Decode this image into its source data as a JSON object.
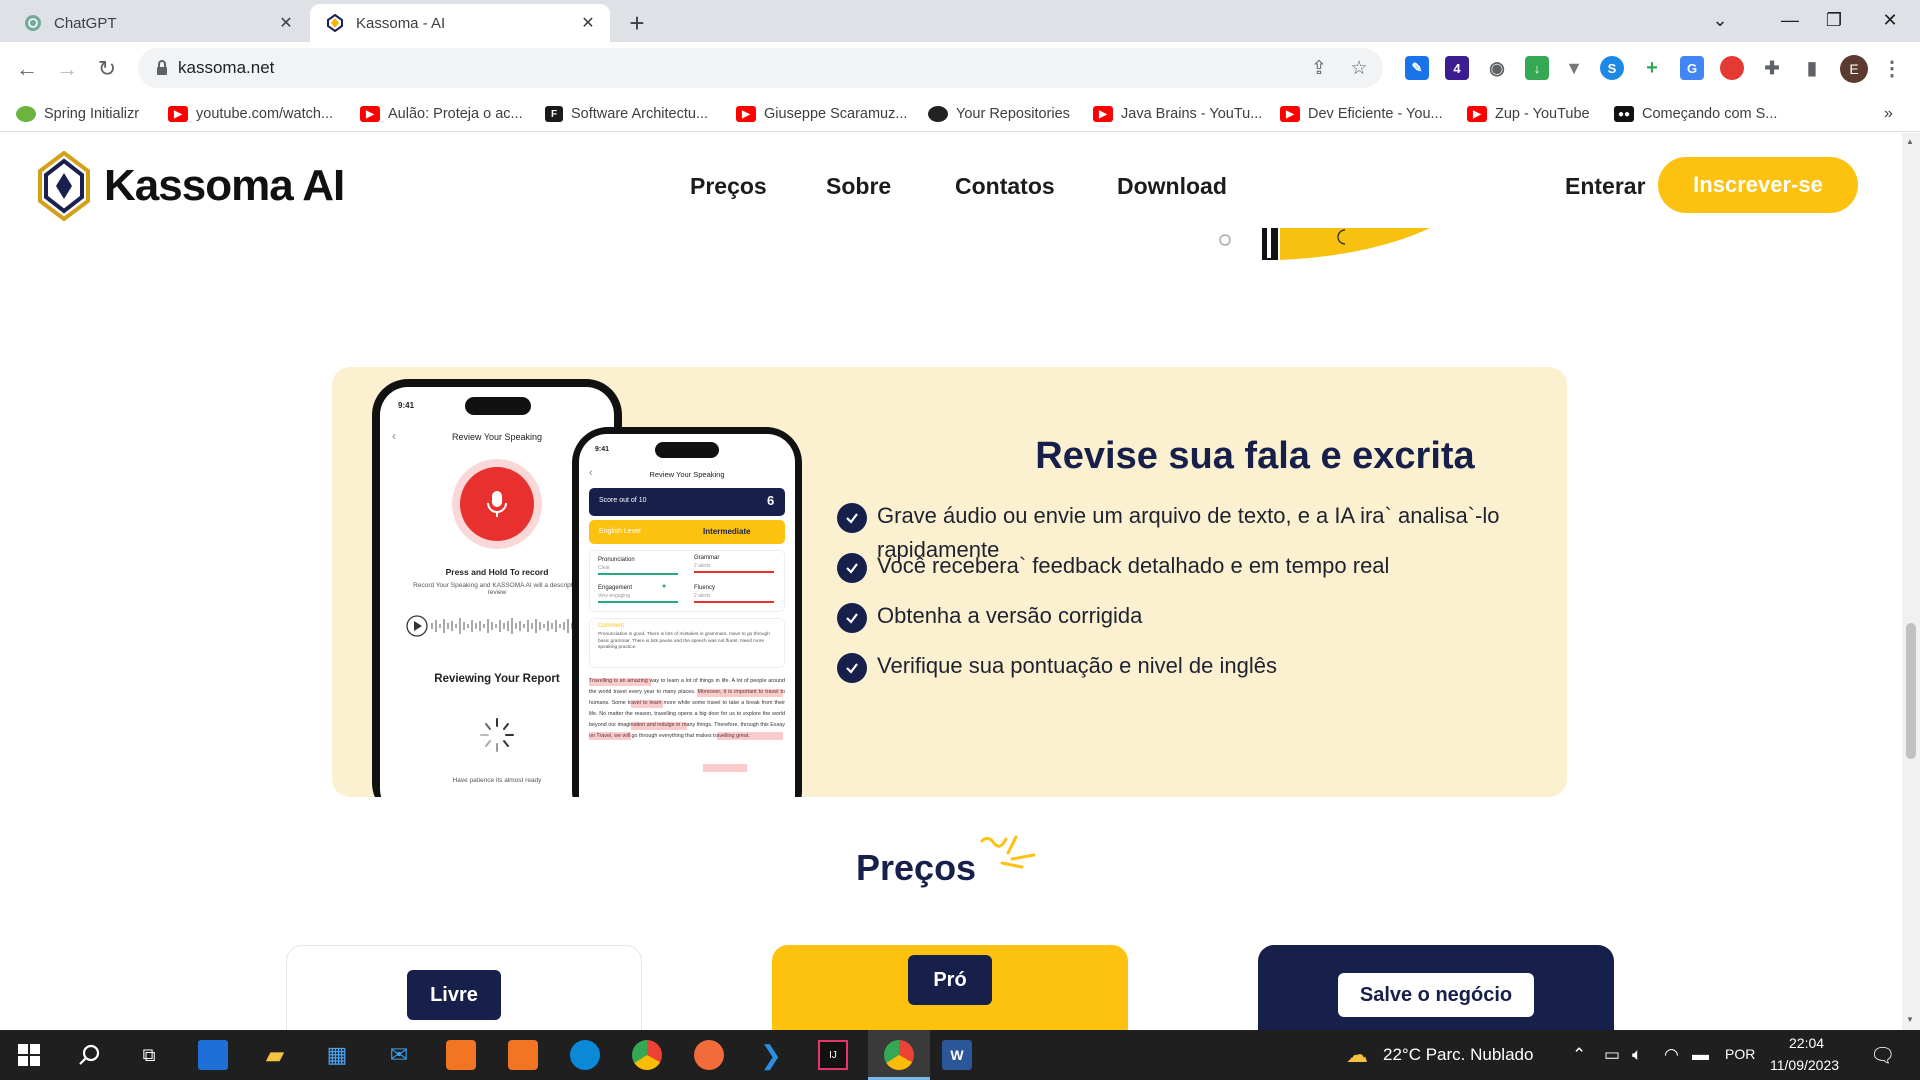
{
  "browser": {
    "tabs": [
      {
        "title": "ChatGPT",
        "active": false
      },
      {
        "title": "Kassoma - AI",
        "active": true
      }
    ],
    "url": "kassoma.net",
    "profile_initial": "E",
    "bookmarks": [
      {
        "label": "Spring Initializr",
        "icon": "spring-icon"
      },
      {
        "label": "youtube.com/watch...",
        "icon": "youtube-icon"
      },
      {
        "label": "Aulão: Proteja o ac...",
        "icon": "youtube-icon"
      },
      {
        "label": "Software Architectu...",
        "icon": "f-icon"
      },
      {
        "label": "Giuseppe Scaramuz...",
        "icon": "youtube-icon"
      },
      {
        "label": "Your Repositories",
        "icon": "github-icon"
      },
      {
        "label": "Java Brains - YouTu...",
        "icon": "youtube-icon"
      },
      {
        "label": "Dev Eficiente - You...",
        "icon": "youtube-icon"
      },
      {
        "label": "Zup - YouTube",
        "icon": "youtube-icon"
      },
      {
        "label": "Começando com S...",
        "icon": "medium-icon"
      }
    ]
  },
  "site": {
    "logo_text": "Kassoma AI",
    "nav": [
      "Preços",
      "Sobre",
      "Contatos",
      "Download"
    ],
    "login": "Enterar",
    "signup": "Inscrever-se",
    "accent_color": "#fdc10f",
    "navy_color": "#17204a",
    "feature": {
      "title": "Revise sua fala e excrita",
      "items": [
        "Grave áudio ou envie um arquivo de texto, e a IA ira` analisa`-lo rapidamente",
        "Você recebera` feedback detalhado e em tempo real",
        "Obtenha a versão corrigida",
        "Verifique sua pontuação e nivel de inglês"
      ],
      "phone1": {
        "time": "9:41",
        "header": "Review Your Speaking",
        "press": "Press and Hold To record",
        "desc": "Record Your Speaking and KASSOMA AI will a descriptive review",
        "reviewing": "Reviewing Your Report",
        "patience": "Have patience its almost ready"
      },
      "phone2": {
        "time": "9:41",
        "header": "Review Your Speaking",
        "score_label": "Score out of 10",
        "score": "6",
        "level_label": "English Level",
        "level": "Intermediate",
        "metrics": [
          {
            "name": "Pronunciation",
            "sub": "Clear"
          },
          {
            "name": "Grammar",
            "sub": "2 alerts"
          },
          {
            "name": "Engagement",
            "sub": "Very engaging"
          },
          {
            "name": "Fluency",
            "sub": "2 alerts"
          }
        ],
        "comment_label": "Comment",
        "comment": "Pronunciation is good. There is lots of mistakes in grammars. Have to go through basic grammar. There is lots pause and the speech was not fluent. Need more speaking practice.",
        "essay": "Travelling is an amazing way to learn a lot of things in life. A lot of people around the world travel every year to many places. Moreover, it is important to travel to humans. Some travel to learn more while some travel to take a break from their life. No matter the reason, travelling opens a big door for us to explore the world beyond our imagination and indulge in many things. Therefore, through this Essay on Travel, we will go through everything that makes travelling great."
      }
    },
    "pricing": {
      "title": "Preços",
      "plans": [
        "Livre",
        "Pró",
        "Salve o negócio"
      ]
    }
  },
  "taskbar": {
    "weather": "22°C  Parc. Nublado",
    "lang": "POR",
    "time": "22:04",
    "date": "11/09/2023"
  }
}
